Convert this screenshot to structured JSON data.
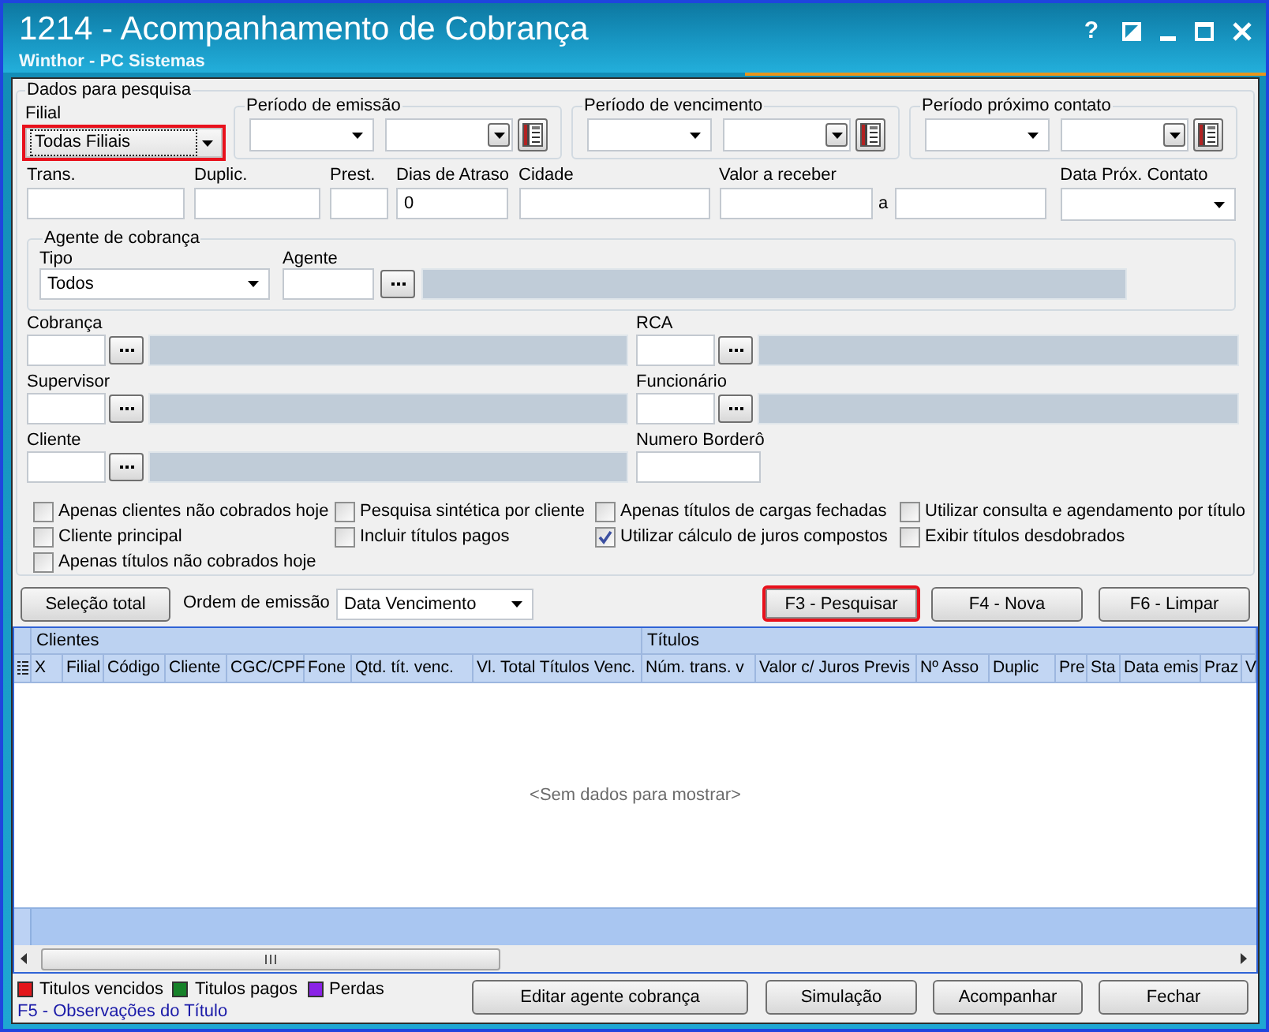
{
  "window": {
    "title": "1214 - Acompanhamento de Cobrança",
    "subtitle": "Winthor - PC Sistemas",
    "help": "?"
  },
  "search": {
    "legend": "Dados para pesquisa",
    "filial": {
      "label": "Filial",
      "value": "Todas Filiais",
      "highlighted": true
    },
    "periods": [
      {
        "legend": "Período de emissão"
      },
      {
        "legend": "Período de vencimento"
      },
      {
        "legend": "Período próximo contato"
      }
    ],
    "fields": [
      {
        "label": "Trans.",
        "kind": "text"
      },
      {
        "label": "Duplic.",
        "kind": "text"
      },
      {
        "label": "Prest.",
        "kind": "text"
      },
      {
        "label": "Dias de Atraso",
        "kind": "text",
        "value": "0"
      },
      {
        "label": "Cidade",
        "kind": "text"
      },
      {
        "label": "Valor a receber",
        "kind": "range",
        "separator": "a"
      },
      {
        "label": "Data Próx. Contato",
        "kind": "combo"
      }
    ],
    "agent_group": {
      "legend": "Agente de cobrança",
      "type": {
        "label": "Tipo",
        "value": "Todos"
      },
      "agent": {
        "label": "Agente"
      }
    },
    "lookups": [
      {
        "label": "Cobrança",
        "kind": "lookup"
      },
      {
        "label": "RCA",
        "kind": "lookup"
      },
      {
        "label": "Supervisor",
        "kind": "lookup"
      },
      {
        "label": "Funcionário",
        "kind": "lookup"
      },
      {
        "label": "Cliente",
        "kind": "lookup"
      },
      {
        "label": "Numero Borderô",
        "kind": "text"
      }
    ],
    "option_columns": [
      [
        {
          "label": "Apenas clientes não cobrados hoje",
          "checked": false
        },
        {
          "label": "Cliente principal",
          "checked": false
        },
        {
          "label": "Apenas títulos não cobrados hoje",
          "checked": false
        }
      ],
      [
        {
          "label": "Pesquisa sintética por cliente",
          "checked": false
        },
        {
          "label": "Incluir títulos pagos",
          "checked": false
        }
      ],
      [
        {
          "label": "Apenas títulos de cargas fechadas",
          "checked": false
        },
        {
          "label": "Utilizar cálculo de juros compostos",
          "checked": true
        }
      ],
      [
        {
          "label": "Utilizar consulta e agendamento por título",
          "checked": false
        },
        {
          "label": "Exibir títulos desdobrados",
          "checked": false
        }
      ]
    ]
  },
  "toolbar": {
    "select_all": "Seleção total",
    "order": {
      "label": "Ordem de emissão",
      "value": "Data Vencimento"
    },
    "actions": [
      {
        "label": "F3 - Pesquisar",
        "highlighted": true
      },
      {
        "label": "F4 - Nova",
        "highlighted": false
      },
      {
        "label": "F6 - Limpar",
        "highlighted": false
      }
    ]
  },
  "grid": {
    "bands": [
      {
        "label": "Clientes",
        "columns": [
          "X",
          "Filial",
          "Código",
          "Cliente",
          "CGC/CPF",
          "Fone",
          "Qtd. tít. venc.",
          "Vl. Total Títulos Venc."
        ]
      },
      {
        "label": "Títulos",
        "columns": [
          "Núm. trans. v",
          "Valor c/ Juros Previs",
          "Nº Asso",
          "Duplic",
          "Pre",
          "Sta",
          "Data emis",
          "Praz",
          "V"
        ]
      }
    ],
    "empty_text": "<Sem dados para mostrar>"
  },
  "legend": [
    {
      "label": "Titulos vencidos",
      "color": "#e3161b"
    },
    {
      "label": "Titulos pagos",
      "color": "#17822a"
    },
    {
      "label": "Perdas",
      "color": "#8a22e6"
    }
  ],
  "hint": "F5 - Observações do Título",
  "buttons": [
    "Editar agente cobrança",
    "Simulação",
    "Acompanhar",
    "Fechar"
  ]
}
